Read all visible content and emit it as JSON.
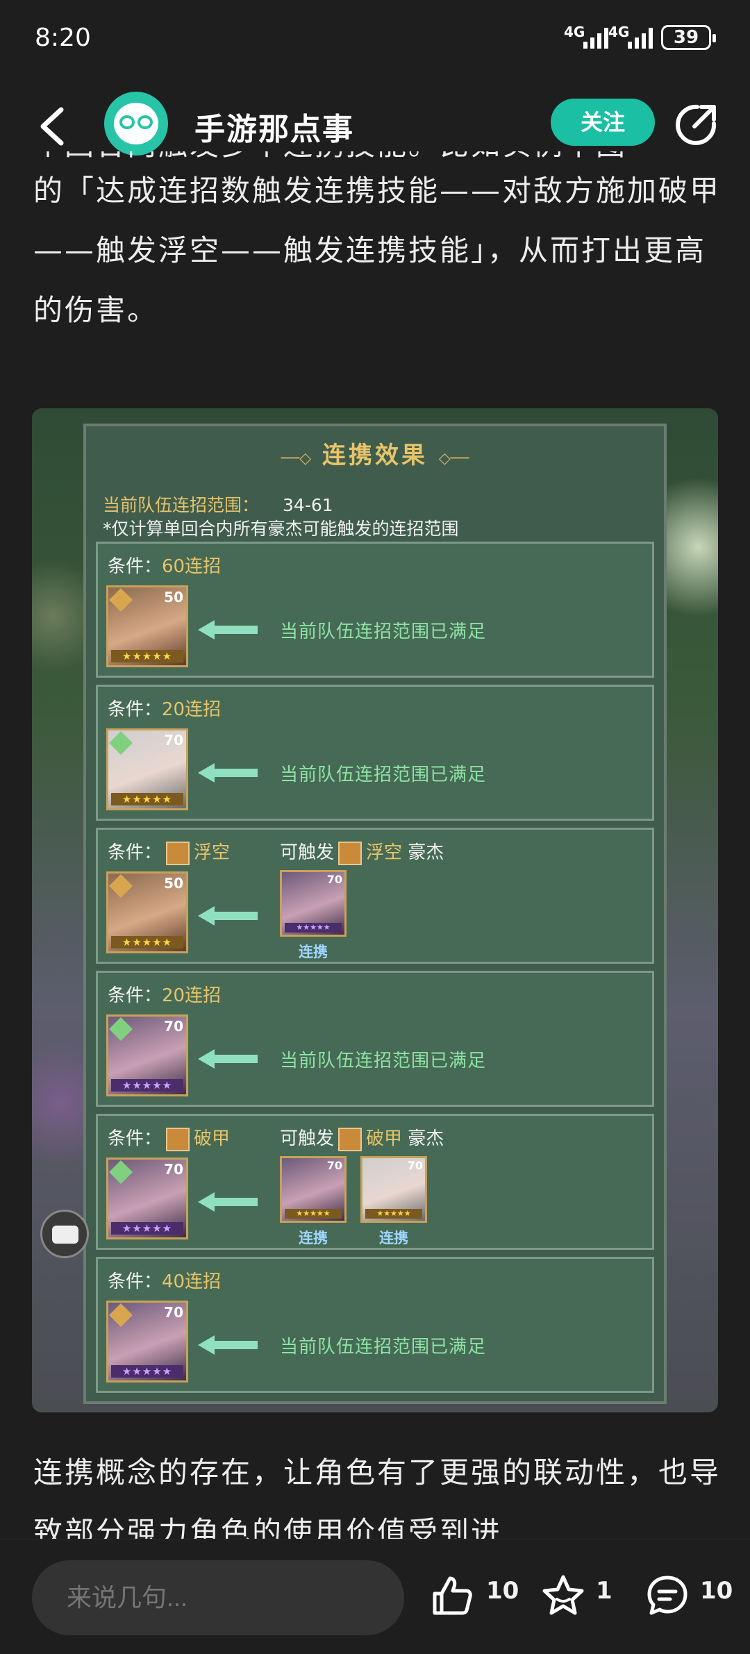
{
  "status": {
    "time": "8:20",
    "net1": "4G",
    "net2": "4G",
    "battery": "39"
  },
  "header": {
    "title": "手游那点事",
    "follow_label": "关注"
  },
  "article": {
    "partial_line": "个回合内触发多个连携技能。比如实例下图",
    "para1": "的「达成连招数触发连携技能——对敌方施加破甲——触发浮空——触发连携技能」，从而打出更高的伤害。",
    "para2": "连携概念的存在，让角色有了更强的联动性，也导致部分强力角色的使用价值受到进"
  },
  "panel": {
    "title": "连携效果",
    "range_label": "当前队伍连招范围：",
    "range_value": "34-61",
    "note": "*仅计算单回合内所有豪杰可能触发的连招范围",
    "cond_prefix": "条件：",
    "trigger_prefix": "可触发",
    "hero_suffix": "豪杰",
    "satisfied": "当前队伍连招范围已满足",
    "link_label": "连携",
    "rows": [
      {
        "cond": "60连招",
        "level": "50",
        "stars": "★★★★★",
        "type": "ok"
      },
      {
        "cond": "20连招",
        "level": "70",
        "stars": "★★★★★",
        "type": "ok"
      },
      {
        "cond": "浮空",
        "level": "50",
        "stars": "★★★★★",
        "type": "trigger",
        "trigger": "浮空",
        "mini_levels": [
          "70"
        ]
      },
      {
        "cond": "20连招",
        "level": "70",
        "stars": "★★★★★",
        "type": "ok"
      },
      {
        "cond": "破甲",
        "level": "70",
        "stars": "★★★★★",
        "type": "trigger",
        "trigger": "破甲",
        "mini_levels": [
          "70",
          "70"
        ]
      },
      {
        "cond": "40连招",
        "level": "70",
        "stars": "★★★★★",
        "type": "ok"
      }
    ]
  },
  "bottom": {
    "comment_placeholder": "来说几句...",
    "likes": "10",
    "favorites": "1",
    "comments": "10"
  },
  "colors": {
    "accent": "#1bbfa4",
    "gold": "#e7c46a",
    "ok_green": "#8ee3a5"
  }
}
